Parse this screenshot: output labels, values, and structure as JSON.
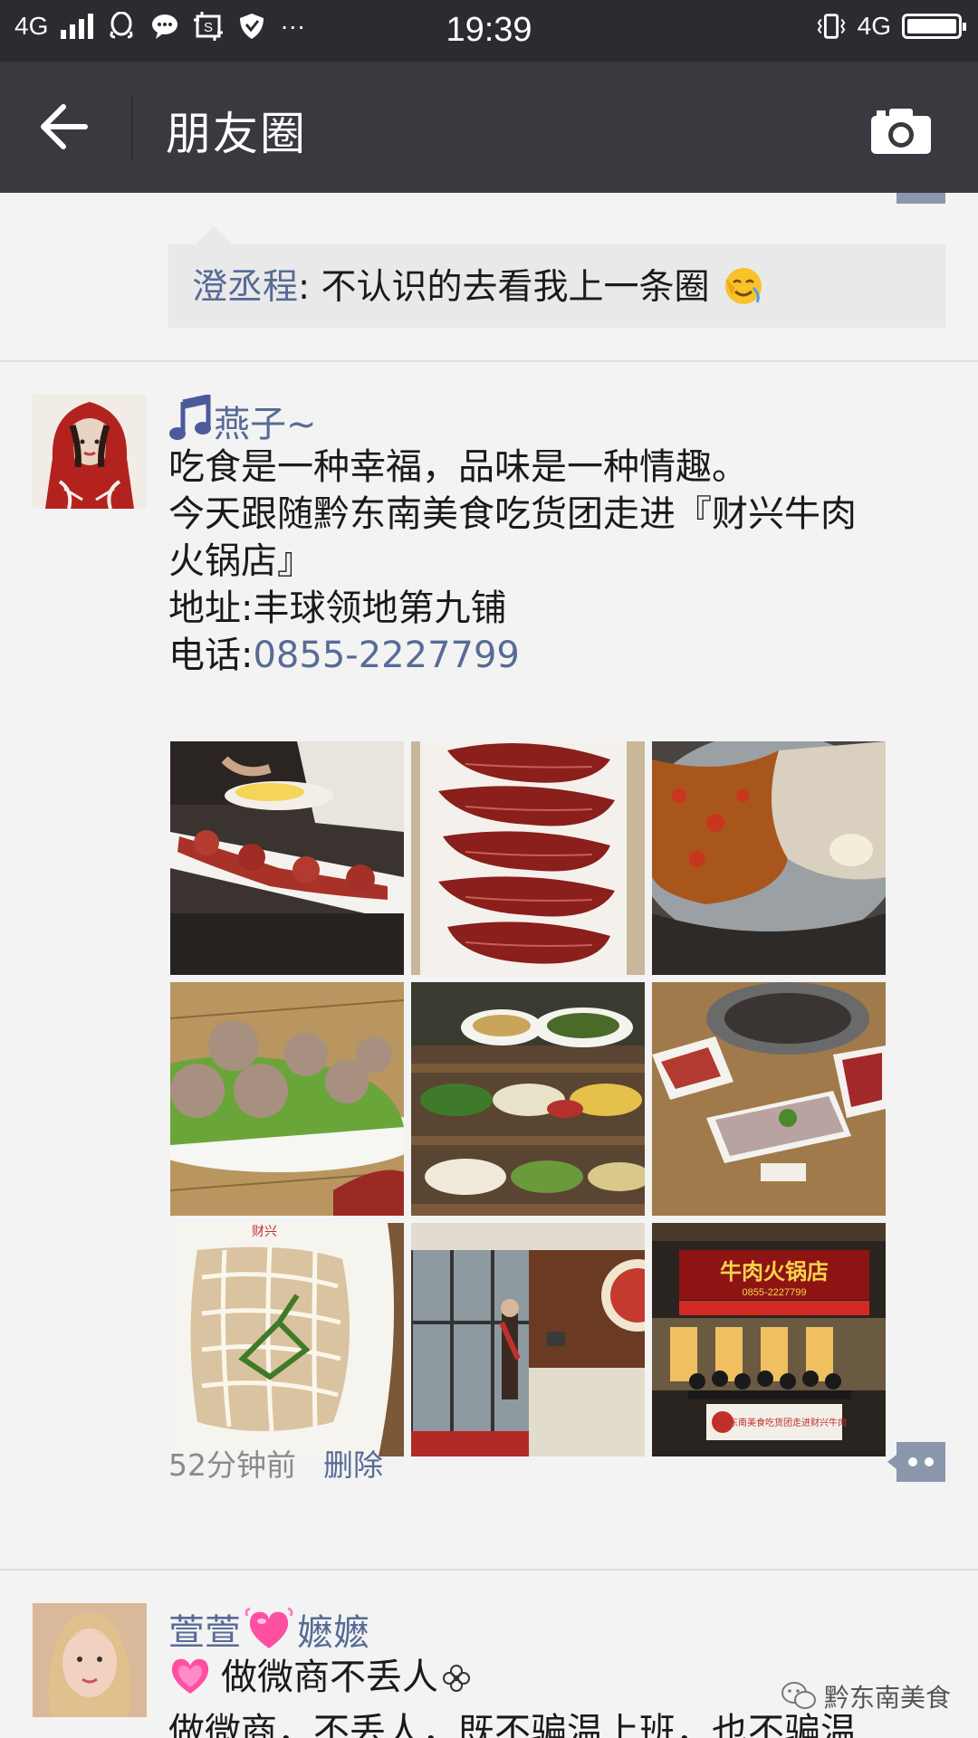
{
  "status_bar": {
    "network_left": "4G",
    "time": "19:39",
    "network_right": "4G",
    "more": "···"
  },
  "header": {
    "title": "朋友圈"
  },
  "prev_post": {
    "comment_author": "澄丞程",
    "comment_text": ": 不认识的去看我上一条圈"
  },
  "post": {
    "author": "燕子~",
    "lines": [
      "吃食是一种幸福，品味是一种情趣。",
      "今天跟随黔东南美食吃货团走进『财兴牛肉",
      "火锅店』",
      "地址:丰球领地第九铺"
    ],
    "phone_label": "电话:",
    "phone_number": "0855-2227799",
    "time_ago": "52分钟前",
    "delete_label": "删除",
    "photo_signs": {
      "shop_name": "牛肉火锅店",
      "shop_phone": "0855-2227799",
      "brand": "财兴",
      "banner": "黔东南美食吃货团走进财兴牛肉"
    }
  },
  "next_post": {
    "author_part1": "萱萱",
    "author_part2": "嬷嬷",
    "line1": "做微商不丢人",
    "line2_partial": "做微商，不丢人，既不骗温上班，也不骗温"
  },
  "watermark": "黔东南美食",
  "colors": {
    "statusbar": "#2a2c2f",
    "titlebar": "#393a3f",
    "link": "#576b95",
    "background": "#f3f3f3"
  }
}
